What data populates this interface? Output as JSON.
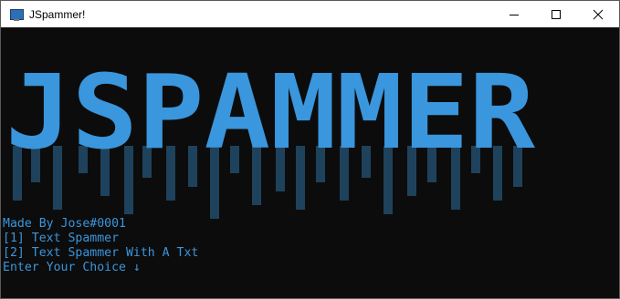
{
  "window": {
    "title": "JSpammer!",
    "icon": "console-app-icon",
    "buttons": [
      "minimize-icon",
      "maximize-icon",
      "close-icon"
    ]
  },
  "banner": {
    "text": "JSPAMMER",
    "color": "#3a96dd",
    "drip_color": "#2f6f9f"
  },
  "console": {
    "background": "#0c0c0c",
    "text_color": "#3a96dd",
    "lines": [
      "Made By Jose#0001",
      "[1] Text Spammer",
      "[2] Text Spammer With A Txt",
      "Enter Your Choice ↓"
    ]
  }
}
